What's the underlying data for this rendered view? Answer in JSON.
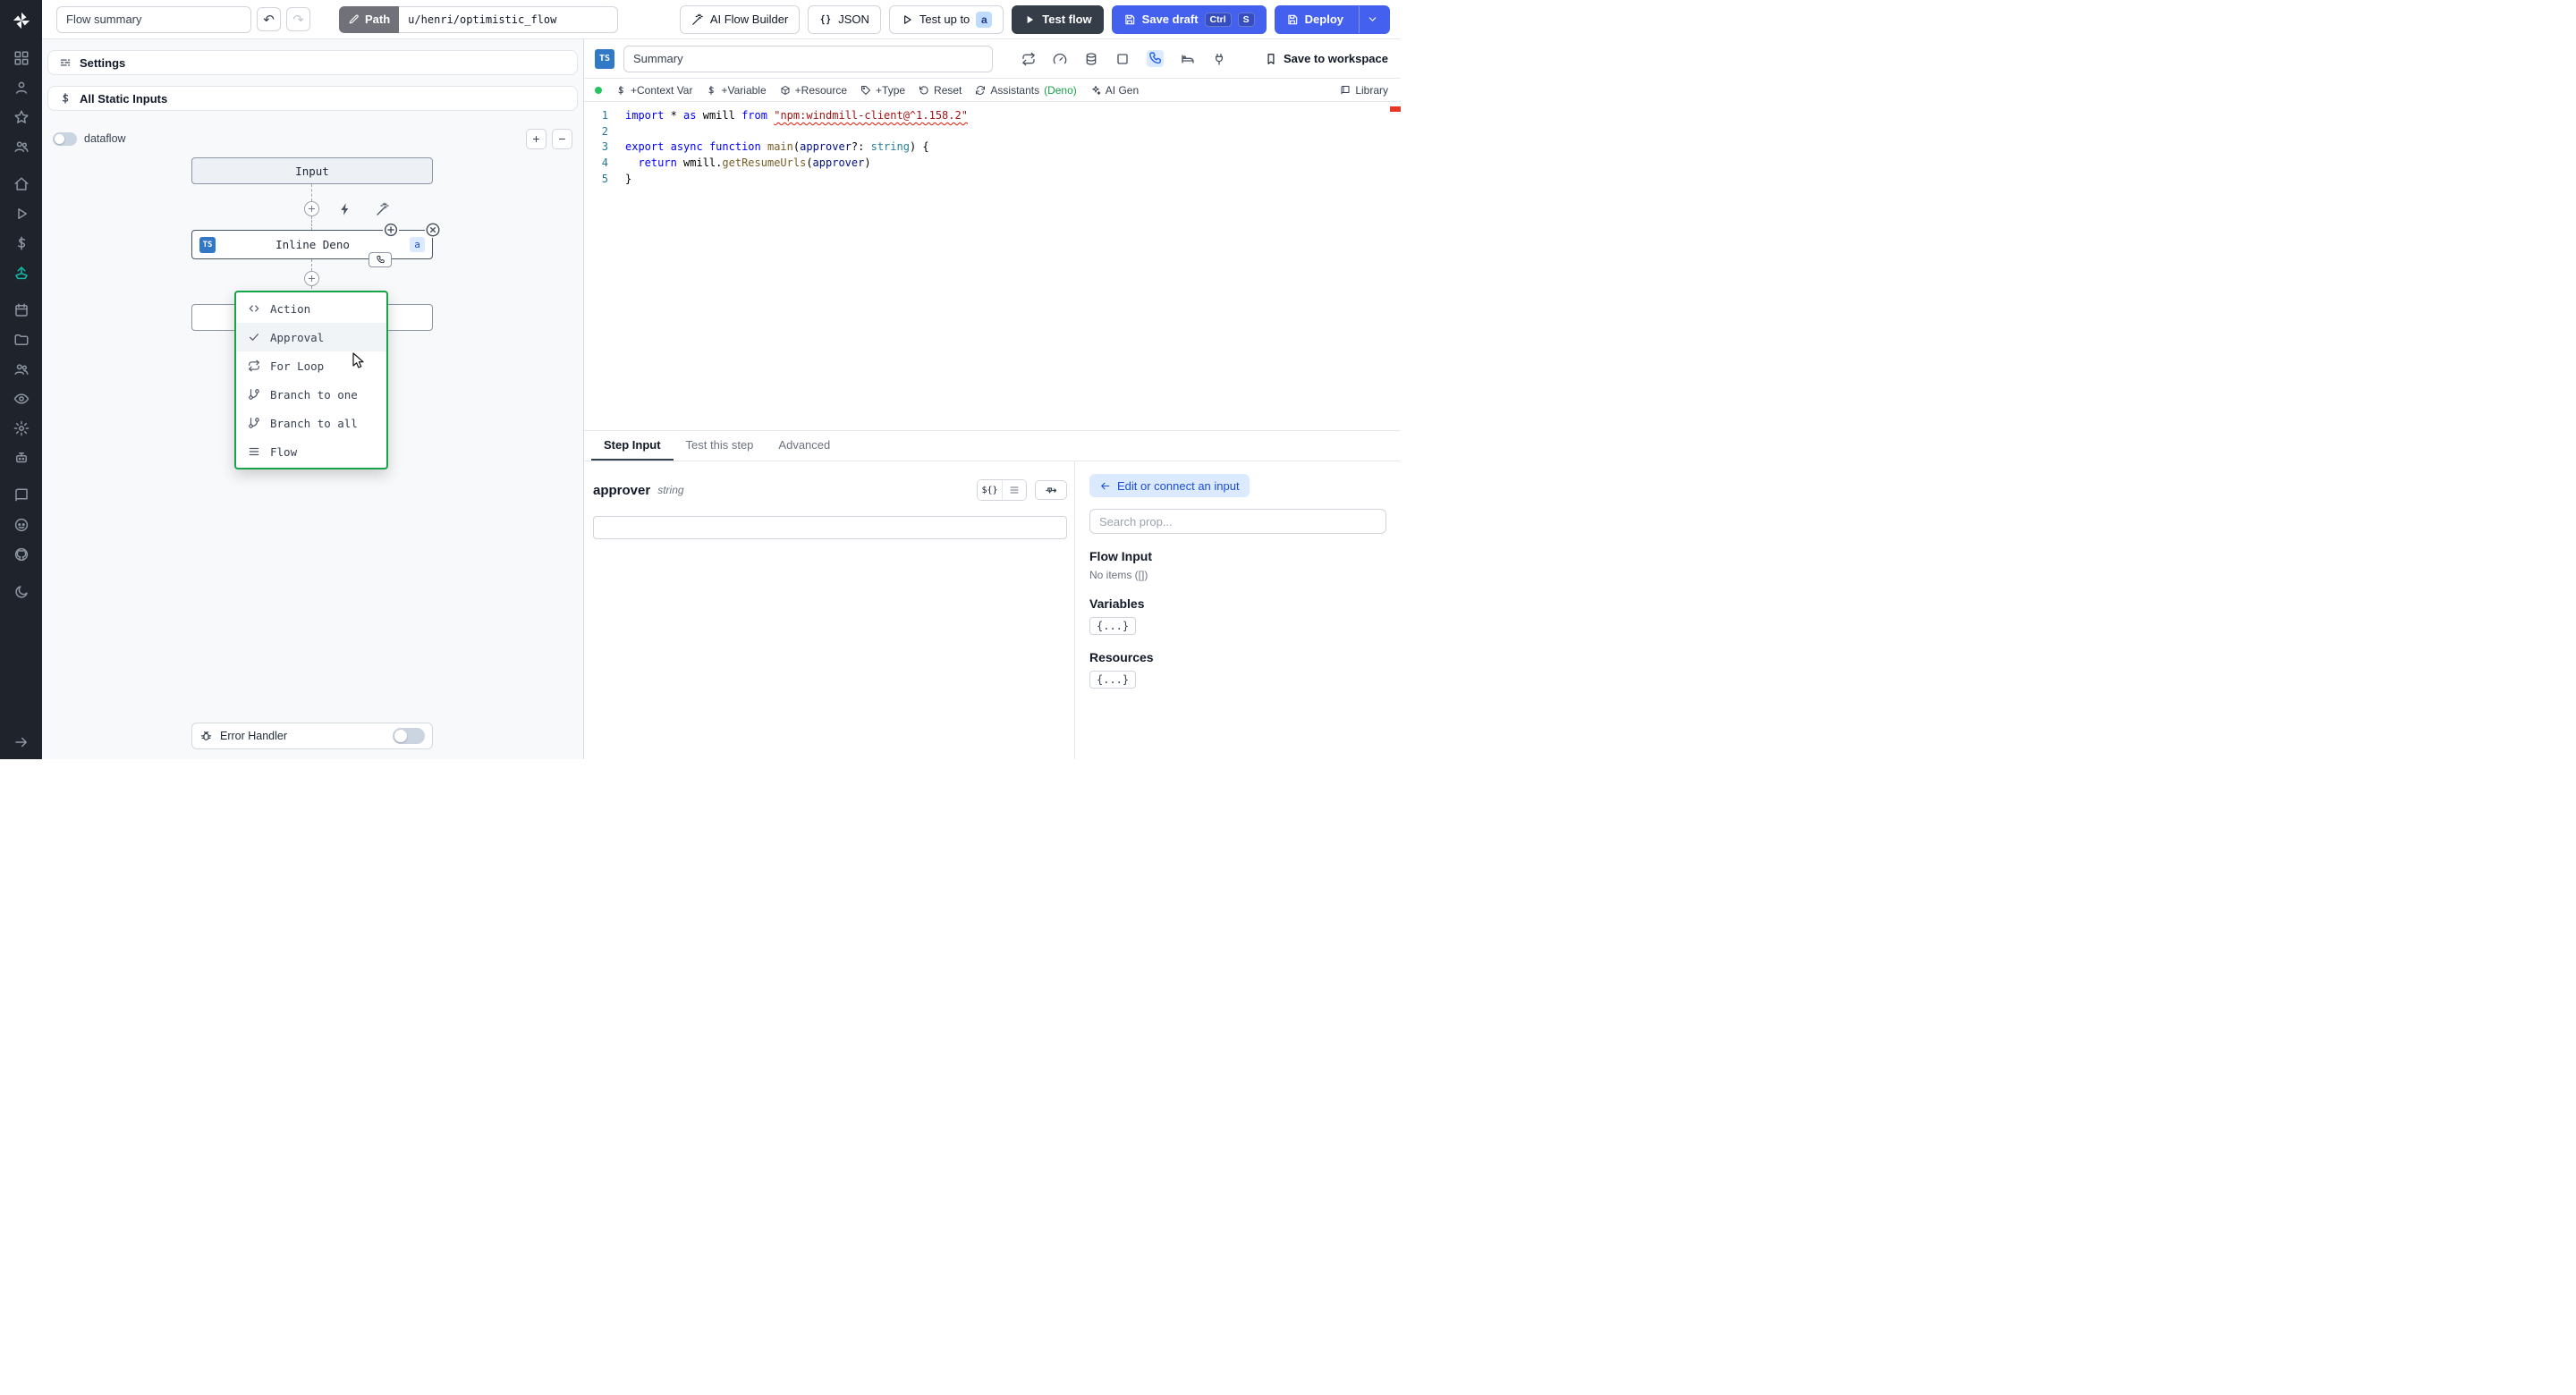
{
  "icon_names": [
    "windmill-logo",
    "grid",
    "user",
    "star",
    "users",
    "home",
    "play",
    "dollar",
    "ship",
    "calendar",
    "folder",
    "team",
    "eye",
    "gear",
    "robot",
    "book",
    "discord",
    "github",
    "moon",
    "arrow-right",
    "sliders",
    "pencil",
    "wand",
    "braces",
    "play-outline",
    "play-fill",
    "save",
    "chevron-down",
    "undo",
    "redo",
    "repeat",
    "gauge",
    "database",
    "square",
    "phone",
    "bed",
    "plug",
    "bookmark",
    "package",
    "tag",
    "reset",
    "refresh",
    "sparkles",
    "library",
    "code",
    "check",
    "branch",
    "flow-lines",
    "bolt",
    "crosshair",
    "close",
    "bug",
    "plus",
    "minus",
    "arrow-left",
    "mouse-cursor"
  ],
  "sidebar": {
    "groups": [
      [
        "grid",
        "user",
        "star",
        "users"
      ],
      [
        "home",
        "play",
        "dollar",
        "ship"
      ],
      [
        "calendar",
        "folder",
        "team",
        "eye",
        "gear",
        "robot"
      ],
      [
        "book",
        "discord",
        "github"
      ],
      [
        "moon"
      ]
    ],
    "accent_icon": "ship"
  },
  "topbar": {
    "summary_placeholder": "Flow summary",
    "undo": "↶",
    "redo": "↷",
    "path_label": "Path",
    "path_value": "u/henri/optimistic_flow",
    "ai_flow_builder": "AI Flow Builder",
    "json": "JSON",
    "test_up_to": "Test up to",
    "test_up_to_badge": "a",
    "test_flow": "Test flow",
    "save_draft": "Save draft",
    "kbd_ctrl": "Ctrl",
    "kbd_s": "S",
    "deploy": "Deploy"
  },
  "flow_panel": {
    "settings": "Settings",
    "all_static_inputs": "All Static Inputs",
    "dataflow": "dataflow",
    "zoom_in": "+",
    "zoom_out": "−",
    "nodes": {
      "input": "Input",
      "inline": "Inline Deno",
      "inline_lang": "TS",
      "inline_badge": "a"
    },
    "menu": {
      "items": [
        {
          "label": "Action",
          "icon": "code"
        },
        {
          "label": "Approval",
          "icon": "check"
        },
        {
          "label": "For Loop",
          "icon": "repeat"
        },
        {
          "label": "Branch to one",
          "icon": "branch"
        },
        {
          "label": "Branch to all",
          "icon": "branch"
        },
        {
          "label": "Flow",
          "icon": "flow-lines"
        }
      ]
    },
    "error_handler": "Error Handler"
  },
  "editor": {
    "lang_badge": "TS",
    "summary_placeholder": "Summary",
    "save_to_workspace": "Save to workspace",
    "actions": {
      "context_var": "+Context Var",
      "variable": "+Variable",
      "resource": "+Resource",
      "type": "+Type",
      "reset": "Reset",
      "assistants": "Assistants",
      "assistants_mode": "(Deno)",
      "ai_gen": "AI Gen",
      "library": "Library"
    },
    "code": {
      "lines": [
        [
          {
            "t": "import",
            "c": "kw"
          },
          {
            "t": " * ",
            "c": "pl"
          },
          {
            "t": "as",
            "c": "kw"
          },
          {
            "t": " wmill ",
            "c": "pl"
          },
          {
            "t": "from",
            "c": "kw"
          },
          {
            "t": " ",
            "c": "pl"
          },
          {
            "t": "\"npm:windmill-client@^1.158.2\"",
            "c": "str err"
          }
        ],
        [],
        [
          {
            "t": "export",
            "c": "kw"
          },
          {
            "t": " ",
            "c": "pl"
          },
          {
            "t": "async",
            "c": "kw"
          },
          {
            "t": " ",
            "c": "pl"
          },
          {
            "t": "function",
            "c": "kw"
          },
          {
            "t": " ",
            "c": "pl"
          },
          {
            "t": "main",
            "c": "fn"
          },
          {
            "t": "(",
            "c": "pl"
          },
          {
            "t": "approver",
            "c": "pm"
          },
          {
            "t": "?: ",
            "c": "pl"
          },
          {
            "t": "string",
            "c": "ty"
          },
          {
            "t": ") {",
            "c": "pl"
          }
        ],
        [
          {
            "t": "  ",
            "c": "pl"
          },
          {
            "t": "return",
            "c": "kw"
          },
          {
            "t": " wmill.",
            "c": "pl"
          },
          {
            "t": "getResumeUrls",
            "c": "fn"
          },
          {
            "t": "(",
            "c": "pl"
          },
          {
            "t": "approver",
            "c": "pm"
          },
          {
            "t": ")",
            "c": "pl"
          }
        ],
        [
          {
            "t": "}",
            "c": "pl"
          }
        ]
      ]
    }
  },
  "step_panel": {
    "tabs": [
      {
        "label": "Step Input",
        "active": true
      },
      {
        "label": "Test this step",
        "active": false
      },
      {
        "label": "Advanced",
        "active": false
      }
    ],
    "field": {
      "name": "approver",
      "type": "string",
      "value": "",
      "expr_toggle": "${}"
    },
    "connect": {
      "edit_button": "Edit or connect an input",
      "search_placeholder": "Search prop...",
      "flow_input": "Flow Input",
      "no_items": "No items ([])",
      "variables": "Variables",
      "variables_chip": "{...}",
      "resources": "Resources",
      "resources_chip": "{...}"
    }
  },
  "colors": {
    "accent_blue": "#4361ee",
    "dark_button": "#353d49",
    "menu_border_green": "#16a34a",
    "error_red": "#e51400",
    "ts_badge_blue": "#3178c6",
    "badge_blue_bg": "#dbeafe"
  }
}
